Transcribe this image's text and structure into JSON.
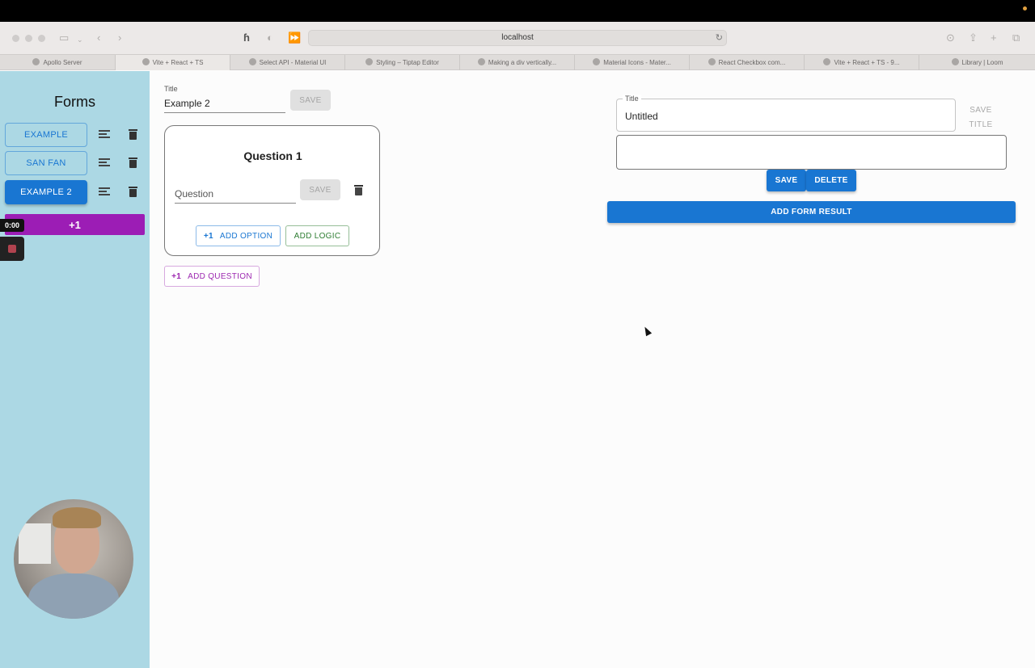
{
  "browser": {
    "url": "localhost",
    "tabs": [
      "Apollo Server",
      "Vite + React + TS",
      "Select API - Material UI",
      "Styling – Tiptap Editor",
      "Making a div vertically...",
      "Material Icons - Mater...",
      "React Checkbox com...",
      "Vite + React + TS - 9...",
      "Library | Loom"
    ]
  },
  "sidebar": {
    "title": "Forms",
    "forms": [
      "EXAMPLE",
      "SAN FAN",
      "EXAMPLE 2"
    ],
    "add_label": "+1"
  },
  "recording": {
    "timer": "0:00"
  },
  "editor": {
    "title_label": "Title",
    "title_value": "Example 2",
    "save_label": "SAVE",
    "question": {
      "heading": "Question 1",
      "placeholder": "Question",
      "save_label": "SAVE",
      "add_option_icon": "+1",
      "add_option_label": "ADD OPTION",
      "add_logic_label": "ADD LOGIC"
    },
    "add_question_icon": "+1",
    "add_question_label": "ADD QUESTION"
  },
  "result": {
    "title_label": "Title",
    "title_value": "Untitled",
    "save_title_label": "SAVE TITLE",
    "save_label": "SAVE",
    "delete_label": "DELETE",
    "add_form_result_label": "ADD FORM RESULT"
  },
  "colors": {
    "sidebar_bg": "#acd8e4",
    "primary": "#1976d2",
    "purple": "#9c1db5"
  }
}
